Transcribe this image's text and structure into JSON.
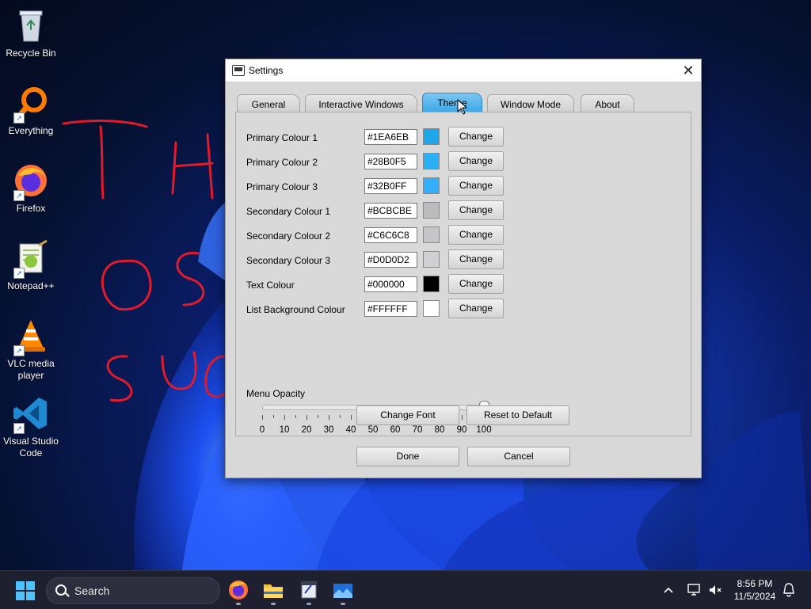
{
  "desktop": {
    "icons": [
      {
        "label": "Recycle Bin",
        "icon": "recycle-bin-icon"
      },
      {
        "label": "Everything",
        "icon": "everything-search-icon"
      },
      {
        "label": "Firefox",
        "icon": "firefox-icon"
      },
      {
        "label": "Notepad++",
        "icon": "notepad-plus-plus-icon"
      },
      {
        "label": "VLC media player",
        "icon": "vlc-icon"
      },
      {
        "label": "Visual Studio Code",
        "icon": "vscode-icon"
      }
    ]
  },
  "dialog": {
    "title": "Settings",
    "close_glyph": "✕",
    "tabs": [
      {
        "label": "General",
        "active": false
      },
      {
        "label": "Interactive Windows",
        "active": false
      },
      {
        "label": "Theme",
        "active": true
      },
      {
        "label": "Window Mode",
        "active": false
      },
      {
        "label": "About",
        "active": false
      }
    ],
    "colour_rows": [
      {
        "label": "Primary Colour 1",
        "hex": "#1EA6EB",
        "swatch": "#1EA6EB",
        "button": "Change"
      },
      {
        "label": "Primary Colour 2",
        "hex": "#28B0F5",
        "swatch": "#28B0F5",
        "button": "Change"
      },
      {
        "label": "Primary Colour 3",
        "hex": "#32B0FF",
        "swatch": "#32B0FF",
        "button": "Change"
      },
      {
        "label": "Secondary Colour 1",
        "hex": "#BCBCBE",
        "swatch": "#BCBCBE",
        "button": "Change"
      },
      {
        "label": "Secondary Colour 2",
        "hex": "#C6C6C8",
        "swatch": "#C6C6C8",
        "button": "Change"
      },
      {
        "label": "Secondary Colour 3",
        "hex": "#D0D0D2",
        "swatch": "#D0D0D2",
        "button": "Change"
      },
      {
        "label": "Text Colour",
        "hex": "#000000",
        "swatch": "#000000",
        "button": "Change"
      },
      {
        "label": "List Background Colour",
        "hex": "#FFFFFF",
        "swatch": "#FFFFFF",
        "button": "Change"
      }
    ],
    "menu_opacity": {
      "label": "Menu Opacity",
      "value": 100,
      "min": 0,
      "max": 100,
      "tick_labels": [
        "0",
        "10",
        "20",
        "30",
        "40",
        "50",
        "60",
        "70",
        "80",
        "90",
        "100"
      ]
    },
    "change_font_label": "Change Font",
    "reset_default_label": "Reset to Default",
    "done_label": "Done",
    "cancel_label": "Cancel"
  },
  "taskbar": {
    "search_text": "Search",
    "apps": [
      "firefox-icon",
      "file-explorer-icon",
      "java-app-icon",
      "photos-icon"
    ],
    "time": "8:56 PM",
    "date": "11/5/2024"
  },
  "colors": {
    "accent": "#3AA6E6",
    "taskbar": "#1E2030",
    "dialog_bg": "#D8D8D8"
  }
}
